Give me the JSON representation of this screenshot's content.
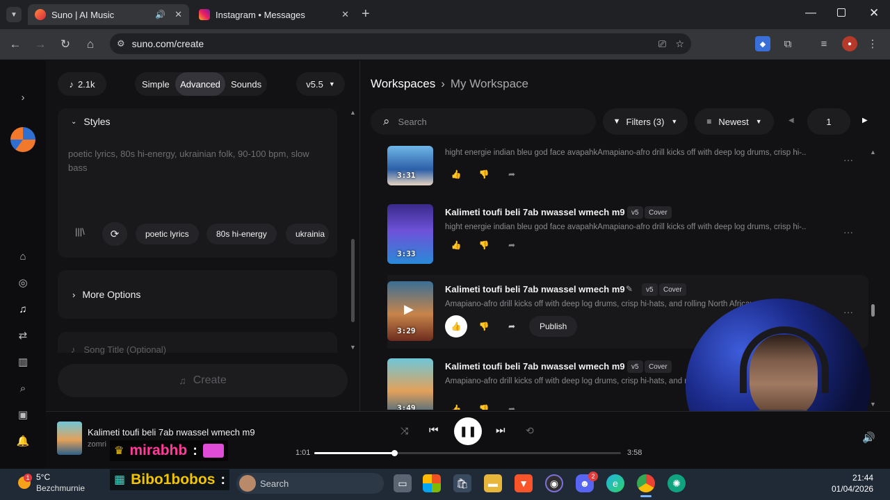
{
  "browser": {
    "tabs": [
      {
        "title": "Suno | AI Music"
      },
      {
        "title": "Instagram • Messages"
      }
    ],
    "url": "suno.com/create"
  },
  "left": {
    "credits": "2.1k",
    "modes": [
      "Simple",
      "Advanced",
      "Sounds"
    ],
    "active_mode": "Advanced",
    "version": "v5.5",
    "styles_label": "Styles",
    "styles_placeholder": "poetic lyrics, 80s hi-energy, ukrainian folk, 90-100 bpm, slow bass",
    "style_tags": [
      "poetic lyrics",
      "80s hi-energy",
      "ukrainia"
    ],
    "more_options": "More Options",
    "song_title_placeholder": "Song Title (Optional)",
    "create_label": "Create"
  },
  "right": {
    "breadcrumb_root": "Workspaces",
    "breadcrumb_current": "My Workspace",
    "search_placeholder": "Search",
    "filters_label": "Filters (3)",
    "sort_label": "Newest",
    "page": "1",
    "songs": [
      {
        "title": "",
        "badge1": "",
        "badge2": "",
        "desc": "hight energie indian bleu god face avapahkAmapiano-afro drill kicks off with deep log drums, crisp hi-...",
        "duration": "3:31"
      },
      {
        "title": "Kalimeti toufi beli 7ab nwassel wmech m9",
        "badge1": "v5",
        "badge2": "Cover",
        "desc": "hight energie indian bleu god face avapahkAmapiano-afro drill kicks off with deep log drums, crisp hi-...",
        "duration": "3:33"
      },
      {
        "title": "Kalimeti toufi beli 7ab nwassel wmech m9",
        "badge1": "v5",
        "badge2": "Cover",
        "desc": "Amapiano-afro drill kicks off with deep log drums, crisp hi-hats, and rolling North African",
        "duration": "3:29",
        "publish": "Publish"
      },
      {
        "title": "Kalimeti toufi beli 7ab nwassel wmech m9",
        "badge1": "v5",
        "badge2": "Cover",
        "desc": "Amapiano-afro drill kicks off with deep log drums, crisp hi-hats, and ro",
        "duration": "3:49"
      }
    ]
  },
  "player": {
    "title": "Kalimeti toufi beli 7ab nwassel wmech m9",
    "artist": "zomri",
    "elapsed": "1:01",
    "total": "3:58",
    "progress": 0.26
  },
  "overlay": {
    "user1": "mirabhb",
    "user2": "Bibo1bobos"
  },
  "taskbar": {
    "weather_temp": "5°C",
    "weather_place": "Bezchmurnie",
    "search_label": "Search",
    "time": "21:44",
    "date": "01/04/2026",
    "discord_badge": "2"
  }
}
